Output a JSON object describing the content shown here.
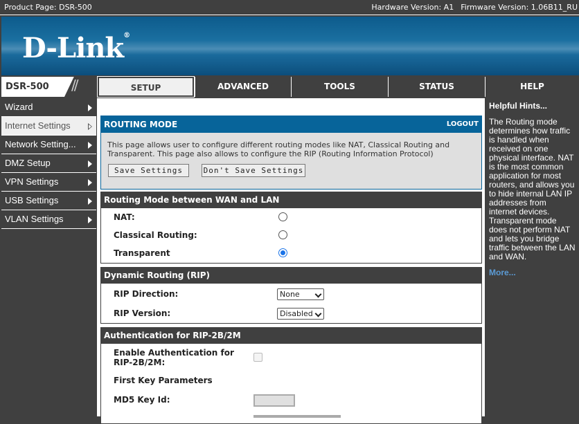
{
  "topbar": {
    "product": "Product Page: DSR-500",
    "hardware": "Hardware Version: A1",
    "firmware": "Firmware Version: 1.06B11_RU"
  },
  "brand": {
    "logo": "D-Link",
    "model": "DSR-500"
  },
  "tabs": [
    "SETUP",
    "ADVANCED",
    "TOOLS",
    "STATUS",
    "HELP"
  ],
  "sidebar": [
    "Wizard",
    "Internet Settings",
    "Network Setting...",
    "DMZ Setup",
    "VPN Settings",
    "USB Settings",
    "VLAN Settings"
  ],
  "routing": {
    "title": "ROUTING MODE",
    "logout": "LOGOUT",
    "desc": "This page allows user to configure different routing modes like NAT, Classical Routing and Transparent. This page also allows to configure the RIP (Routing Information Protocol)",
    "save": "Save Settings",
    "dont_save": "Don't Save Settings"
  },
  "mode": {
    "title": "Routing Mode between WAN and LAN",
    "nat": "NAT:",
    "classical": "Classical Routing:",
    "transparent": "Transparent",
    "selected": "Transparent"
  },
  "rip": {
    "title": "Dynamic Routing (RIP)",
    "direction_label": "RIP Direction:",
    "direction": "None",
    "version_label": "RIP Version:",
    "version": "Disabled"
  },
  "auth": {
    "title": "Authentication for RIP-2B/2M",
    "enable_label": "Enable Authentication for RIP-2B/2M:",
    "first_key": "First Key Parameters",
    "md5_label": "MD5 Key Id:",
    "md5_value": ""
  },
  "hints": {
    "title": "Helpful Hints...",
    "text": "The Routing mode determines how traffic is handled when received on one physical interface. NAT is the most common application for most routers, and allows you to hide internal LAN IP addresses from internet devices. Transparent mode does not perform NAT and lets you bridge traffic between the LAN and WAN.",
    "more": "More..."
  }
}
